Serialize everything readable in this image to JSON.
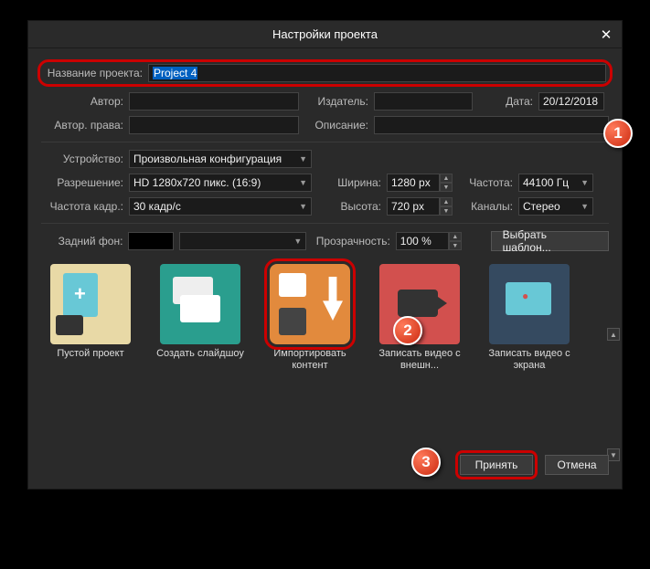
{
  "title": "Настройки проекта",
  "labels": {
    "project_name": "Название проекта:",
    "author": "Автор:",
    "copyright": "Автор. права:",
    "publisher": "Издатель:",
    "description": "Описание:",
    "date": "Дата:",
    "device": "Устройство:",
    "resolution": "Разрешение:",
    "framerate": "Частота кадр.:",
    "width": "Ширина:",
    "height": "Высота:",
    "frequency": "Частота:",
    "channels": "Каналы:",
    "background": "Задний фон:",
    "opacity": "Прозрачность:"
  },
  "values": {
    "project_name": "Project 4",
    "date": "20/12/2018",
    "device": "Произвольная конфигурация",
    "resolution": "HD 1280x720 пикс. (16:9)",
    "framerate": "30 кадр/с",
    "width": "1280 px",
    "height": "720 px",
    "frequency": "44100 Гц",
    "channels": "Стерео",
    "opacity": "100 %"
  },
  "buttons": {
    "choose_template": "Выбрать шаблон...",
    "accept": "Принять",
    "cancel": "Отмена"
  },
  "templates": [
    {
      "label": "Пустой проект"
    },
    {
      "label": "Создать слайдшоу"
    },
    {
      "label": "Импортировать контент"
    },
    {
      "label": "Записать видео с внешн..."
    },
    {
      "label": "Записать видео с экрана"
    }
  ],
  "badges": {
    "b1": "1",
    "b2": "2",
    "b3": "3"
  }
}
